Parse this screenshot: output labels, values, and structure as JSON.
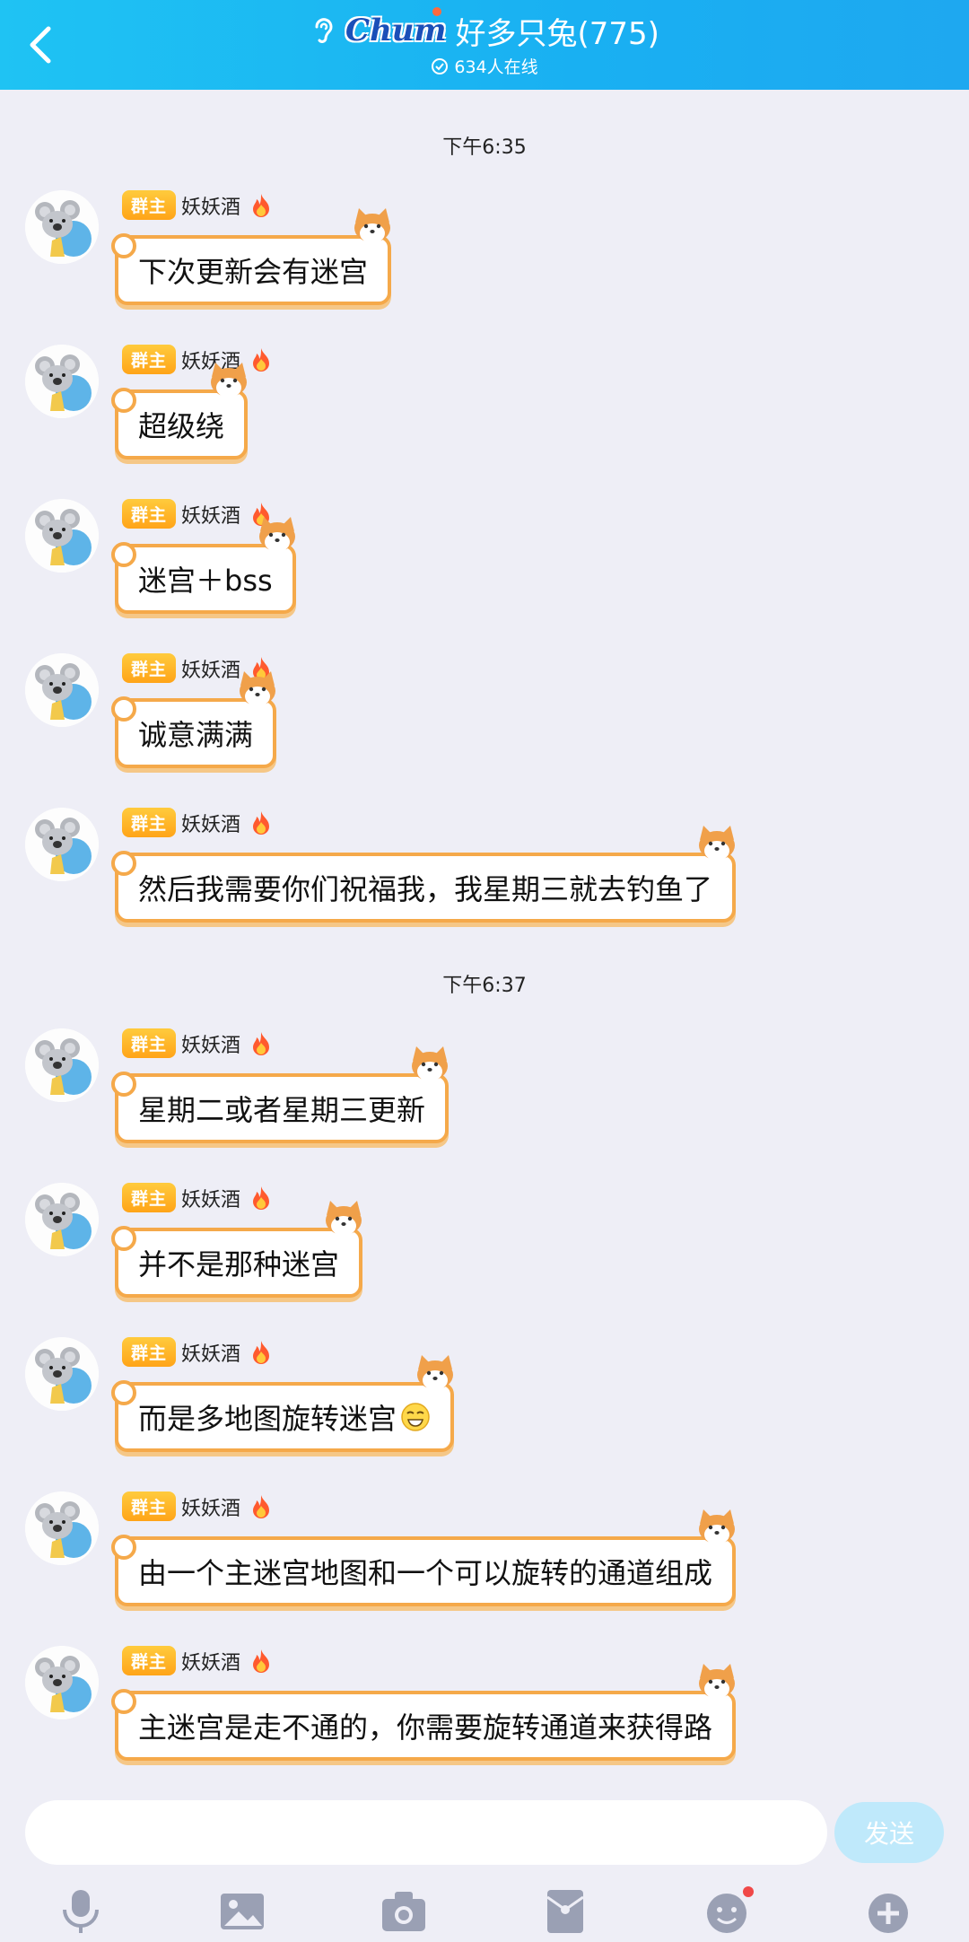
{
  "header": {
    "brand": "Chum",
    "title": "好多只兔(775)",
    "online": "634人在线"
  },
  "times": [
    "下午6:35",
    "下午6:37"
  ],
  "sender": {
    "role": "群主",
    "name": "妖妖酒"
  },
  "messages": [
    {
      "text": "下次更新会有迷宫"
    },
    {
      "text": "超级绕"
    },
    {
      "text": "迷宫＋bss"
    },
    {
      "text": "诚意满满"
    },
    {
      "text": "然后我需要你们祝福我，我星期三就去钓鱼了"
    },
    {
      "text": "星期二或者星期三更新"
    },
    {
      "text": "并不是那种迷宫"
    },
    {
      "text": "而是多地图旋转迷宫",
      "emoji": "grin-emoji"
    },
    {
      "text": "由一个主迷宫地图和一个可以旋转的通道组成"
    },
    {
      "text": "主迷宫是走不通的，你需要旋转通道来获得路"
    }
  ],
  "input": {
    "placeholder": "",
    "send_label": "发送"
  },
  "toolbar": [
    "microphone-icon",
    "image-icon",
    "camera-icon",
    "red-packet-icon",
    "emoji-icon",
    "plus-icon"
  ],
  "colors": {
    "header": "#1ab6f2",
    "bubble_border": "#f5a94a",
    "badge": "#ffa418",
    "send": "#bfe9fb"
  }
}
